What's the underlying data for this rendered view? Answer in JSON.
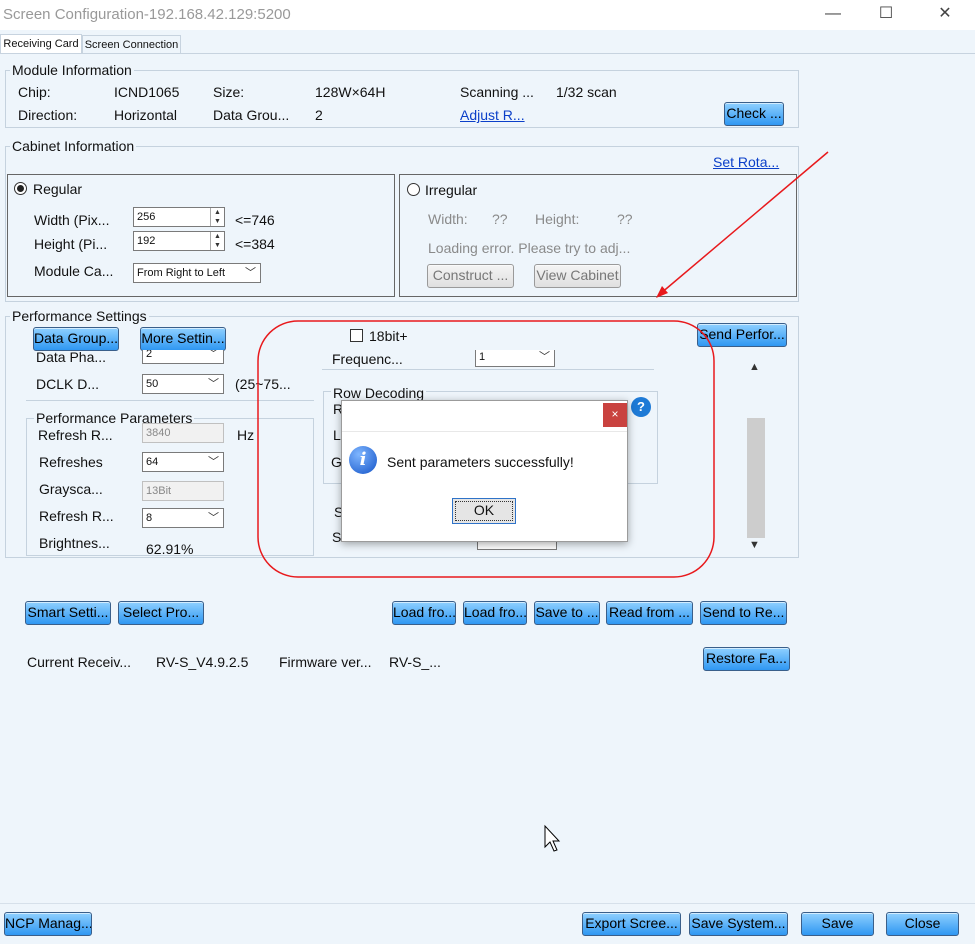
{
  "window": {
    "title": "Screen Configuration-192.168.42.129:5200",
    "minimize_glyph": "—",
    "maximize_glyph": "☐",
    "close_glyph": "✕"
  },
  "tabs": [
    {
      "label": "Receiving Card",
      "active": true
    },
    {
      "label": "Screen Connection",
      "active": false
    }
  ],
  "module_info": {
    "title": "Module Information",
    "chip_label": "Chip:",
    "chip_value": "ICND1065",
    "size_label": "Size:",
    "size_value": "128W×64H",
    "scanning_label": "Scanning ...",
    "scanning_value": "1/32 scan",
    "direction_label": "Direction:",
    "direction_value": "Horizontal",
    "data_group_label": "Data Grou...",
    "data_group_value": "2",
    "adjust_link": "Adjust R...",
    "check_button": "Check ..."
  },
  "cabinet_info": {
    "title": "Cabinet Information",
    "set_rotation_link": "Set Rota...",
    "regular": {
      "label": "Regular",
      "width_label": "Width (Pix...",
      "width_value": "256",
      "width_limit": "<=746",
      "height_label": "Height (Pi...",
      "height_value": "192",
      "height_limit": "<=384",
      "module_cascade_label": "Module Ca...",
      "module_cascade_value": "From Right to Left"
    },
    "irregular": {
      "label": "Irregular",
      "width_label": "Width:",
      "width_value": "??",
      "height_label": "Height:",
      "height_value": "??",
      "error_text": "Loading error. Please try to adj...",
      "construct_button": "Construct ...",
      "view_cabinet_button": "View Cabinet"
    }
  },
  "performance": {
    "title": "Performance Settings",
    "data_group_button": "Data Group...",
    "more_settings_button": "More Settin...",
    "bit18_label": "18bit+",
    "send_button": "Send Perfor...",
    "data_phase_label": "Data Pha...",
    "data_phase_value": "2",
    "dclk_label": "DCLK D...",
    "dclk_value": "50",
    "dclk_range": "(25~75...",
    "frequency_label": "Frequenc...",
    "frequency_value": "1",
    "params_title": "Performance Parameters",
    "refresh_rate_label": "Refresh R...",
    "refresh_rate_value": "3840",
    "refresh_rate_unit": "Hz",
    "refreshes_label": "Refreshes",
    "refreshes_value": "64",
    "grayscale_label": "Graysca...",
    "grayscale_value": "13Bit",
    "refresh_r2_label": "Refresh R...",
    "refresh_r2_value": "8",
    "brightness_label": "Brightnes...",
    "brightness_value": "62.91%",
    "row_decoding_title": "Row Decoding",
    "row_hidden_1": "R",
    "row_hidden_2": "L",
    "row_hidden_3": "G",
    "row_hidden_4": "S",
    "row_hidden_5": "S",
    "scroll_up": "▲",
    "scroll_down": "▼"
  },
  "actions": {
    "smart_settings": "Smart Setti...",
    "select_profile": "Select Pro...",
    "load_from_1": "Load fro...",
    "load_from_2": "Load fro...",
    "save_to": "Save to ...",
    "read_from": "Read from ...",
    "send_to_receiving": "Send to Re...",
    "restore_factory": "Restore Fa..."
  },
  "firmware": {
    "current_label": "Current Receiv...",
    "current_value": "RV-S_V4.9.2.5",
    "firmware_label": "Firmware ver...",
    "firmware_value": "RV-S_..."
  },
  "dialog": {
    "message": "Sent parameters successfully!",
    "ok_button": "OK",
    "close_glyph": "×",
    "info_glyph": "i"
  },
  "bottom": {
    "ncp_manage": "NCP Manag...",
    "export_screen": "Export Scree...",
    "save_system": "Save System...",
    "save": "Save",
    "close": "Close"
  },
  "help_glyph": "?",
  "colors": {
    "annotation_red": "#e8191c",
    "button_blue": "#2f97f2",
    "link_blue": "#0b3fc9"
  }
}
